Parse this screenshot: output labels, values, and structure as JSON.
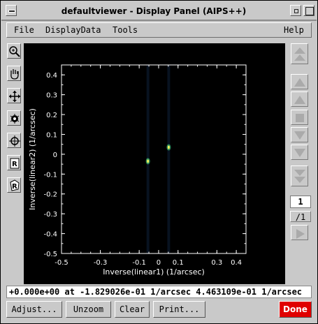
{
  "window": {
    "title": "defaultviewer - Display Panel (AIPS++)"
  },
  "menu": {
    "file": "File",
    "displaydata": "DisplayData",
    "tools": "Tools",
    "help": "Help"
  },
  "tools": [
    "zoom-icon",
    "pan-hand-icon",
    "move-arrows-icon",
    "colormap-icon",
    "crosshair-icon",
    "rectangle-region-icon",
    "polygon-region-icon"
  ],
  "chart_data": {
    "type": "scatter",
    "xlabel": "Inverse(linear1) (1/arcsec)",
    "ylabel": "Inverse(linear2) (1/arcsec)",
    "xlim": [
      -0.5,
      0.45
    ],
    "ylim": [
      -0.5,
      0.45
    ],
    "xticks": [
      "-0.5",
      "-0.3",
      "-0.1",
      "0",
      "0.1",
      "0.3",
      "0.4"
    ],
    "yticks": [
      "0.4",
      "0.3",
      "0.2",
      "0.1",
      "0",
      "-0.1",
      "-0.2",
      "-0.3",
      "-0.4",
      "-0.5"
    ],
    "points": [
      {
        "x": -0.055,
        "y": -0.035
      },
      {
        "x": 0.052,
        "y": 0.035
      }
    ],
    "background": "#000000"
  },
  "frame": {
    "current": "1",
    "total": "/1"
  },
  "status": {
    "text": "+0.000e+00  at -1.829026e-01 1/arcsec 4.463109e-01 1/arcsec"
  },
  "buttons": {
    "adjust": "Adjust...",
    "unzoom": "Unzoom",
    "clear": "Clear",
    "print": "Print...",
    "done": "Done"
  }
}
